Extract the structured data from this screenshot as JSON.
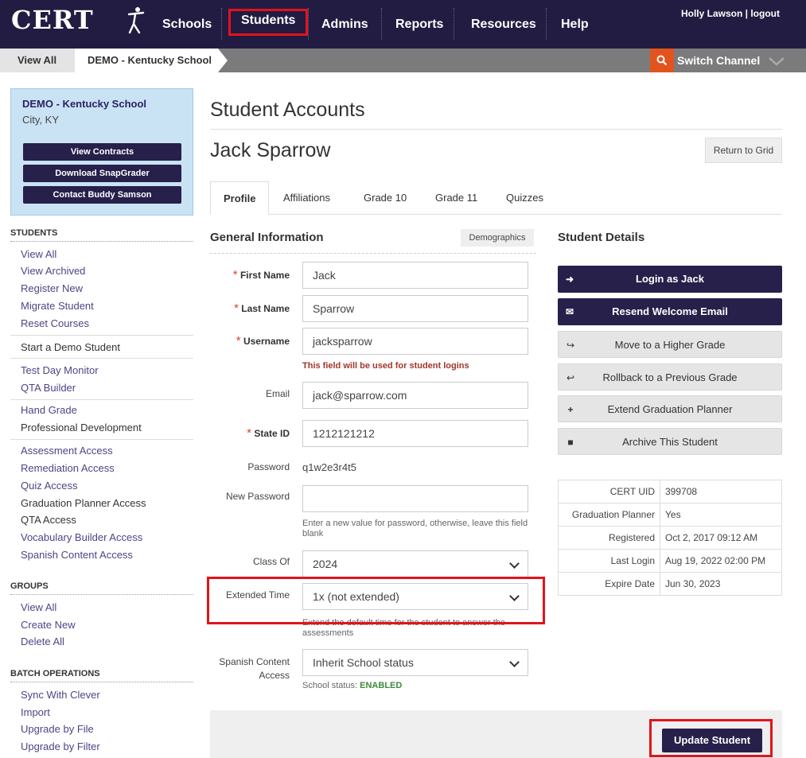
{
  "brand": {
    "logo": "CERT"
  },
  "nav": {
    "items": [
      "Schools",
      "Students",
      "Admins",
      "Reports",
      "Resources",
      "Help"
    ],
    "active": "Students"
  },
  "user": {
    "text": "Holly Lawson | logout"
  },
  "breadcrumb": {
    "view_all": "View All",
    "current": "DEMO - Kentucky School"
  },
  "switch_channel": "Switch Channel",
  "school": {
    "name": "DEMO - Kentucky School",
    "city": "City, KY",
    "buttons": [
      "View Contracts",
      "Download SnapGrader",
      "Contact Buddy Samson"
    ]
  },
  "sidebar": {
    "students_heading": "STUDENTS",
    "students_links": [
      "View All",
      "View Archived",
      "Register New",
      "Migrate Student",
      "Reset Courses",
      "Start a Demo Student",
      "Test Day Monitor",
      "QTA Builder",
      "Hand Grade",
      "Professional Development",
      "Assessment Access",
      "Remediation Access",
      "Quiz Access",
      "Graduation Planner Access",
      "QTA Access",
      "Vocabulary Builder Access",
      "Spanish Content Access"
    ],
    "groups_heading": "GROUPS",
    "groups_links": [
      "View All",
      "Create New",
      "Delete All"
    ],
    "batch_heading": "BATCH OPERATIONS",
    "batch_links": [
      "Sync With Clever",
      "Import",
      "Upgrade by File",
      "Upgrade by Filter"
    ]
  },
  "page": {
    "title": "Student Accounts",
    "student_name": "Jack Sparrow",
    "return_label": "Return to Grid"
  },
  "tabs": [
    "Profile",
    "Affiliations",
    "Grade 10",
    "Grade 11",
    "Quizzes"
  ],
  "general": {
    "heading": "General Information",
    "demographics": "Demographics",
    "first_name_label": "First Name",
    "first_name": "Jack",
    "last_name_label": "Last Name",
    "last_name": "Sparrow",
    "username_label": "Username",
    "username": "jacksparrow",
    "username_note": "This field will be used for student logins",
    "email_label": "Email",
    "email": "jack@sparrow.com",
    "state_id_label": "State ID",
    "state_id": "1212121212",
    "password_label": "Password",
    "password": "q1w2e3r4t5",
    "new_password_label": "New Password",
    "new_password": "",
    "new_password_help": "Enter a new value for password, otherwise, leave this field blank",
    "class_of_label": "Class Of",
    "class_of": "2024",
    "extended_time_label": "Extended Time",
    "extended_time": "1x (not extended)",
    "extended_time_help": "Extend the default time for the student to answer the assessments",
    "spanish_label": "Spanish Content Access",
    "spanish": "Inherit School status",
    "school_status_label": "School status:",
    "school_status": "ENABLED"
  },
  "details": {
    "heading": "Student Details",
    "buttons": [
      "Login as Jack",
      "Resend Welcome Email",
      "Move to a Higher Grade",
      "Rollback to a Previous Grade",
      "Extend Graduation Planner",
      "Archive This Student"
    ],
    "rows": [
      {
        "k": "CERT UID",
        "v": "399708"
      },
      {
        "k": "Graduation Planner",
        "v": "Yes"
      },
      {
        "k": "Registered",
        "v": "Oct 2, 2017 09:12 AM"
      },
      {
        "k": "Last Login",
        "v": "Aug 19, 2022 02:00 PM"
      },
      {
        "k": "Expire Date",
        "v": "Jun 30, 2023"
      }
    ]
  },
  "update_label": "Update Student",
  "colors": {
    "nav_bg": "#231c42",
    "accent_red": "#e1141b",
    "button_dark": "#27204a",
    "link": "#4e4485",
    "search_orange": "#e2541e"
  }
}
